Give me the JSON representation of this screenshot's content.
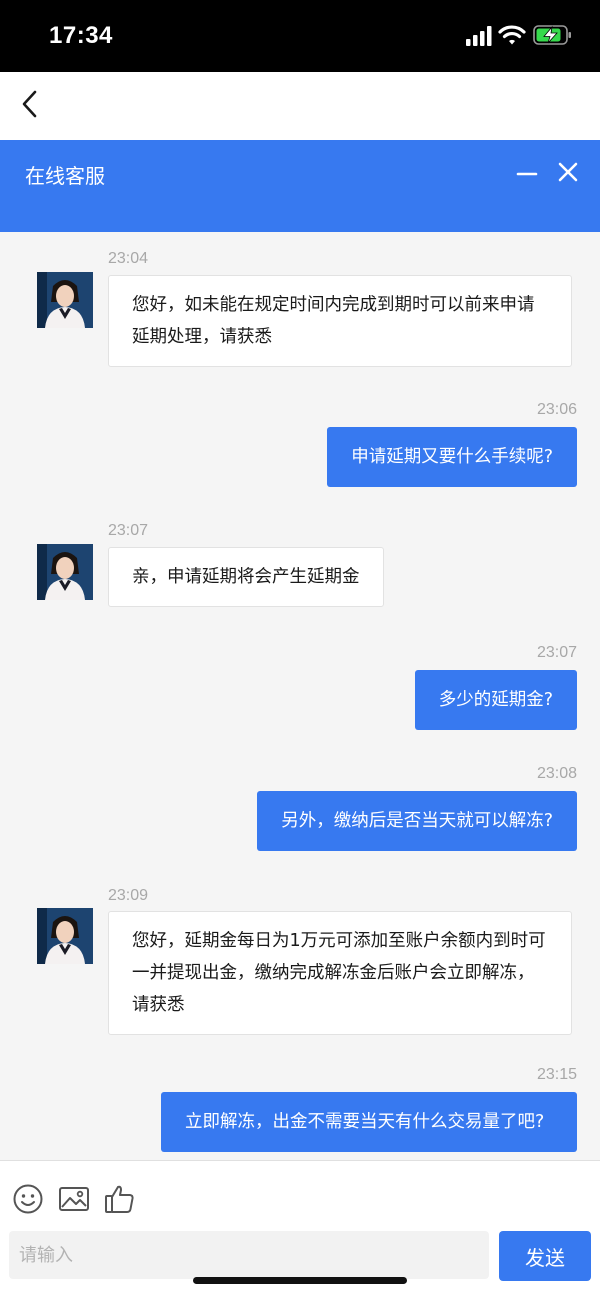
{
  "status_bar": {
    "time": "17:34"
  },
  "chat_header": {
    "title": "在线客服"
  },
  "messages": [
    {
      "from": "agent",
      "time": "23:04",
      "text": "您好，如未能在规定时间内完成到期时可以前来申请延期处理，请获悉"
    },
    {
      "from": "user",
      "time": "23:06",
      "text": "申请延期又要什么手续呢?"
    },
    {
      "from": "agent",
      "time": "23:07",
      "text": "亲，申请延期将会产生延期金"
    },
    {
      "from": "user",
      "time": "23:07",
      "text": "多少的延期金?"
    },
    {
      "from": "user",
      "time": "23:08",
      "text": "另外，缴纳后是否当天就可以解冻?"
    },
    {
      "from": "agent",
      "time": "23:09",
      "text": "您好，延期金每日为1万元可添加至账户余额内到时可一并提现出金，缴纳完成解冻金后账户会立即解冻，请获悉"
    },
    {
      "from": "user",
      "time": "23:15",
      "text": "立即解冻，出金不需要当天有什么交易量了吧?"
    }
  ],
  "input": {
    "placeholder": "请输入",
    "value": ""
  },
  "send_label": "发送",
  "colors": {
    "accent": "#3779f0",
    "agent_bubble": "#ffffff",
    "background": "#f5f5f5"
  },
  "icons": [
    "back-arrow-icon",
    "minimize-icon",
    "close-icon",
    "emoji-icon",
    "image-icon",
    "thumbs-up-icon",
    "signal-icon",
    "wifi-icon",
    "battery-charging-icon"
  ]
}
